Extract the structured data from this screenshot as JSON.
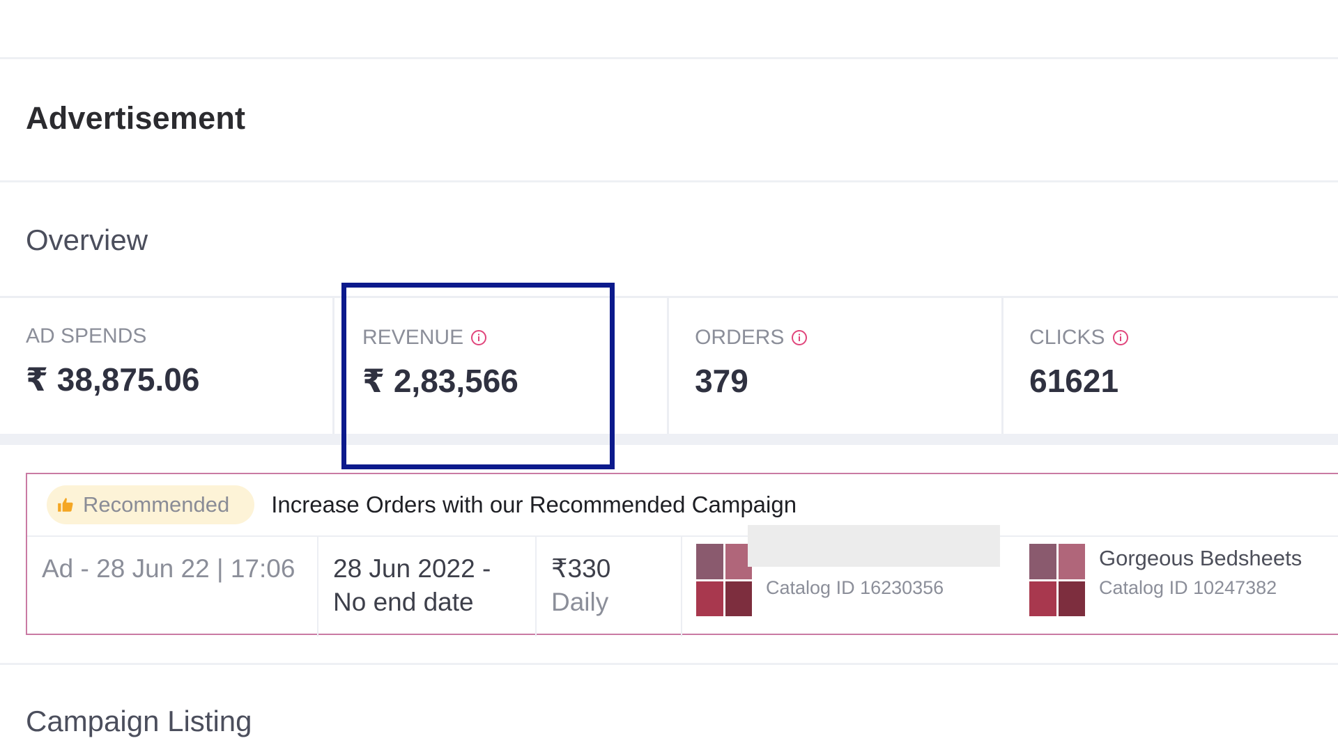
{
  "header": {
    "title": "Advertisement"
  },
  "overview": {
    "title": "Overview",
    "metrics": [
      {
        "label": "AD SPENDS",
        "value": "₹ 38,875.06",
        "has_info": false
      },
      {
        "label": "REVENUE",
        "value": "₹ 2,83,566",
        "has_info": true
      },
      {
        "label": "ORDERS",
        "value": "379",
        "has_info": true
      },
      {
        "label": "CLICKS",
        "value": "61621",
        "has_info": true
      }
    ]
  },
  "recommended": {
    "badge": "Recommended",
    "title": "Increase Orders with our Recommended Campaign",
    "ad_name": "Ad - 28 Jun 22 | 17:06",
    "date_line1": "28 Jun 2022 -",
    "date_line2": "No end date",
    "budget_amount": "₹330",
    "budget_period": "Daily",
    "catalogs": [
      {
        "name": "",
        "id": "Catalog ID 16230356"
      },
      {
        "name": "Gorgeous Bedsheets",
        "id": "Catalog ID 10247382"
      }
    ]
  },
  "campaign_listing": {
    "title": "Campaign Listing"
  },
  "icons": {
    "info": "info-circle-icon",
    "recommended": "thumbs-up-icon"
  },
  "colors": {
    "highlight_border": "#0c1a8c",
    "card_border": "#c97aa3",
    "info_icon": "#e0457b",
    "badge_bg": "#fdf3d7",
    "thumbs_up": "#f4a623"
  }
}
